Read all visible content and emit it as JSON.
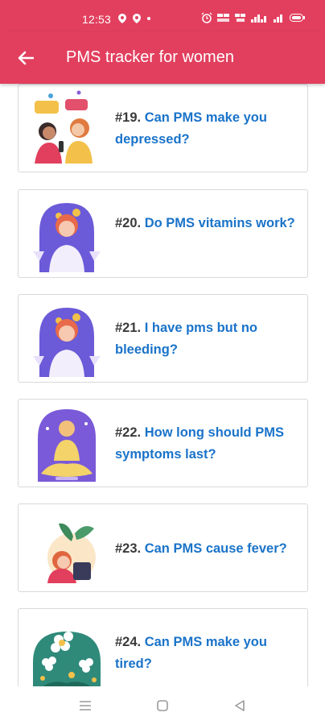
{
  "status": {
    "time": "12:53"
  },
  "appbar": {
    "title": "PMS tracker for women"
  },
  "articles": [
    {
      "number": "#19.",
      "question": "Can PMS make you depressed?",
      "thumb": "women-talking-icon"
    },
    {
      "number": "#20.",
      "question": "Do PMS vitamins work?",
      "thumb": "woman-meditating-icon"
    },
    {
      "number": "#21.",
      "question": "I have pms but no bleeding?",
      "thumb": "woman-meditating-icon"
    },
    {
      "number": "#22.",
      "question": "How long should PMS symptoms last?",
      "thumb": "woman-yoga-icon"
    },
    {
      "number": "#23.",
      "question": "Can PMS cause fever?",
      "thumb": "woman-plant-icon"
    },
    {
      "number": "#24.",
      "question": "Can PMS make you tired?",
      "thumb": "flowers-icon"
    }
  ],
  "colors": {
    "primary": "#e23f5e",
    "link": "#1a73c9",
    "number": "#3a3a3a"
  }
}
